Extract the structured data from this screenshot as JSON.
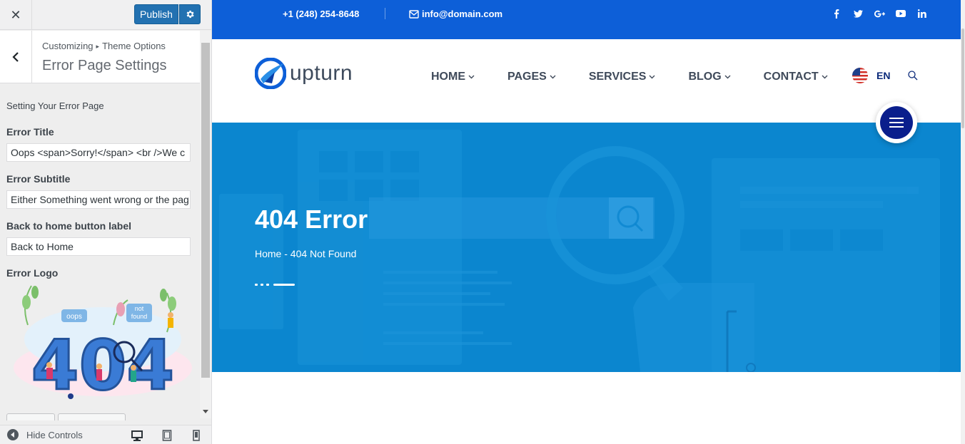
{
  "customizer": {
    "close_glyph": "✕",
    "publish_label": "Publish",
    "breadcrumb": {
      "parent": "Customizing",
      "separator": "▸",
      "current": "Theme Options"
    },
    "section_title": "Error Page Settings",
    "description": "Setting Your Error Page",
    "fields": [
      {
        "label": "Error Title",
        "value": "Oops <span>Sorry!</span> <br />We c"
      },
      {
        "label": "Error Subtitle",
        "value": "Either Something went wrong or the pag"
      },
      {
        "label": "Back to home button label",
        "value": "Back to Home"
      }
    ],
    "logo_label": "Error Logo",
    "logo_art": {
      "big_text": "404",
      "bubble_oops": "oops",
      "bubble_not": "not",
      "bubble_found": "found"
    },
    "footer": {
      "hide_controls_label": "Hide Controls"
    }
  },
  "site": {
    "topbar": {
      "phone": "+1 (248) 254-8648",
      "email": "info@domain.com",
      "socials": [
        "f",
        "t",
        "g+",
        "yt",
        "in"
      ]
    },
    "brand": {
      "name": "upturn",
      "color": "#0d5fd8"
    },
    "nav": [
      "HOME",
      "PAGES",
      "SERVICES",
      "BLOG",
      "CONTACT"
    ],
    "language": "EN",
    "hero": {
      "title": "404 Error",
      "breadcrumb": "Home - 404 Not Found",
      "bg_color": "#0b86cf"
    },
    "accent_color": "#0a1e8c"
  }
}
